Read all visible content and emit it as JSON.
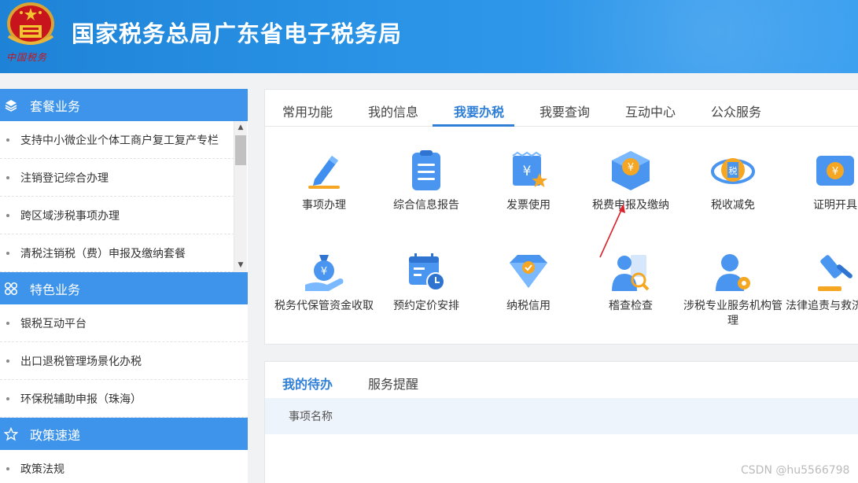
{
  "header": {
    "title": "国家税务总局广东省电子税务局",
    "emblem_caption": "中国税务",
    "emblem_icon": "tax-emblem-icon"
  },
  "sidebar": {
    "sections": [
      {
        "title": "套餐业务",
        "icon": "layers-icon",
        "items": [
          "支持中小微企业个体工商户复工复产专栏",
          "注销登记综合办理",
          "跨区域涉税事项办理",
          "清税注销税（费）申报及缴纳套餐"
        ]
      },
      {
        "title": "特色业务",
        "icon": "grid-clover-icon",
        "items": [
          "银税互动平台",
          "出口退税管理场景化办税",
          "环保税辅助申报（珠海）"
        ]
      },
      {
        "title": "政策速递",
        "icon": "star-outline-icon",
        "items": [
          "政策法规"
        ]
      }
    ]
  },
  "main": {
    "tabs": [
      "常用功能",
      "我的信息",
      "我要办税",
      "我要查询",
      "互动中心",
      "公众服务"
    ],
    "active_tab": "我要办税",
    "functions_row1": [
      {
        "label": "事项办理",
        "icon": "pen-icon"
      },
      {
        "label": "综合信息报告",
        "icon": "clipboard-icon"
      },
      {
        "label": "发票使用",
        "icon": "invoice-star-icon"
      },
      {
        "label": "税费申报及缴纳",
        "icon": "yuan-cube-icon"
      },
      {
        "label": "税收减免",
        "icon": "tax-coin-icon"
      },
      {
        "label": "证明开具",
        "icon": "yuan-ticket-icon"
      }
    ],
    "functions_row2": [
      {
        "label": "税务代保管资金收取",
        "icon": "money-bag-hand-icon"
      },
      {
        "label": "预约定价安排",
        "icon": "calendar-clock-icon"
      },
      {
        "label": "纳税信用",
        "icon": "diamond-check-icon"
      },
      {
        "label": "稽查检查",
        "icon": "inspector-magnifier-icon"
      },
      {
        "label": "涉税专业服务机构管理",
        "icon": "person-gear-icon"
      },
      {
        "label": "法律追责与救济事项",
        "icon": "gavel-icon"
      }
    ]
  },
  "todo": {
    "tabs": [
      "我的待办",
      "服务提醒"
    ],
    "active_tab": "我的待办",
    "column_header": "事项名称"
  },
  "watermark": "CSDN @hu5566798",
  "colors": {
    "header_blue": "#2a8fe3",
    "sidebar_head_blue": "#3d94ea",
    "active_tab_blue": "#2f7fd7",
    "annotation_red": "#d9232d"
  }
}
